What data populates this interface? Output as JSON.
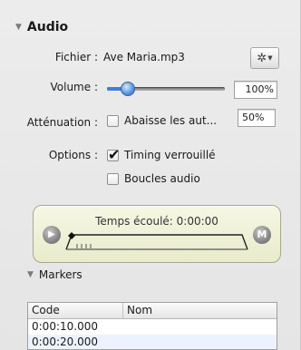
{
  "audio": {
    "title": "Audio",
    "file_label": "Fichier :",
    "file_name": "Ave Maria.mp3",
    "gear_icon": "gear-icon",
    "volume_label": "Volume :",
    "volume_value": "100%",
    "volume_level": 0.18,
    "attenuation_label": "Atténuation :",
    "attenuation_checkbox": "Abaisse les aut...",
    "attenuation_checked": false,
    "attenuation_value": "50%",
    "options_label": "Options :",
    "timing_label": "Timing verrouillé",
    "timing_checked": true,
    "loop_label": "Boucles audio",
    "loop_checked": false
  },
  "timeline": {
    "elapsed_text": "Temps écoulé: 0:00:00",
    "play_icon": "play-icon",
    "marker_button_label": "M"
  },
  "markers": {
    "title": "Markers",
    "columns": [
      "Code",
      "Nom"
    ],
    "rows": [
      {
        "code": "0:00:10.000",
        "name": ""
      },
      {
        "code": "0:00:20.000",
        "name": ""
      }
    ]
  }
}
